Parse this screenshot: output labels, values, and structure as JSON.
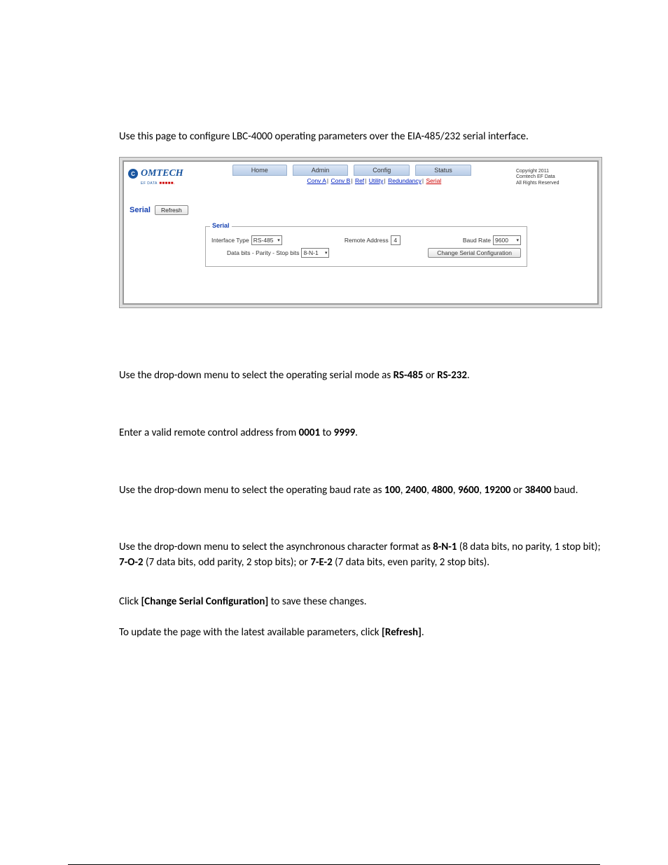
{
  "intro": "Use this page to configure LBC-4000 operating parameters over the EIA-485/232 serial interface.",
  "screenshot": {
    "logo": {
      "text": "OMTECH",
      "sub": "EF DATA",
      "tail": "■■■■■."
    },
    "copyright": {
      "l1": "Copyright 2011",
      "l2": "Comtech EF Data",
      "l3": "All Rights Reserved"
    },
    "nav": {
      "home": "Home",
      "admin": "Admin",
      "config": "Config",
      "status": "Status"
    },
    "subnav": {
      "a": "Conv A",
      "b": "Conv B",
      "ref": "Ref",
      "util": "Utility",
      "red": "Redundancy",
      "serial": "Serial"
    },
    "section": {
      "title": "Serial",
      "refresh": "Refresh"
    },
    "panel": {
      "title": "Serial",
      "interface_label": "Interface Type",
      "interface_value": "RS-485",
      "remote_label": "Remote Address",
      "remote_value": "4",
      "baud_label": "Baud Rate",
      "baud_value": "9600",
      "bits_label": "Data bits - Parity - Stop bits",
      "bits_value": "8-N-1",
      "change_btn": "Change Serial Configuration"
    }
  },
  "p_interface_pre": "Use the drop-down menu to select the operating serial mode as ",
  "p_interface_b1": "RS-485",
  "p_interface_mid": " or ",
  "p_interface_b2": "RS-232",
  "p_interface_end": ".",
  "p_remote_pre": "Enter a valid remote control address from ",
  "p_remote_b1": "0001",
  "p_remote_mid": " to ",
  "p_remote_b2": "9999",
  "p_remote_end": ".",
  "p_baud_pre": "Use the drop-down menu to select the operating baud rate as ",
  "p_baud_b1": "100",
  "p_baud_c": ", ",
  "p_baud_b2": "2400",
  "p_baud_b3": "4800",
  "p_baud_b4": "9600",
  "p_baud_b5": "19200",
  "p_baud_or": " or ",
  "p_baud_b6": "38400",
  "p_baud_end": " baud.",
  "p_bits_pre": "Use the drop-down menu to select the asynchronous character format as ",
  "p_bits_b1": "8-N-1",
  "p_bits_t1": " (8 data bits, no parity, 1 stop bit); ",
  "p_bits_b2": "7-O-2",
  "p_bits_t2": " (7 data bits, odd parity, 2 stop bits); or ",
  "p_bits_b3": "7-E-2",
  "p_bits_t3": " (7 data bits, even parity, 2 stop bits).",
  "p_click_pre": "Click ",
  "p_click_b1": "[Change Serial Configuration]",
  "p_click_end": " to save these changes.",
  "p_refresh_pre": "To update the page with the latest available parameters, click ",
  "p_refresh_b1": "[Refresh]",
  "p_refresh_end": "."
}
